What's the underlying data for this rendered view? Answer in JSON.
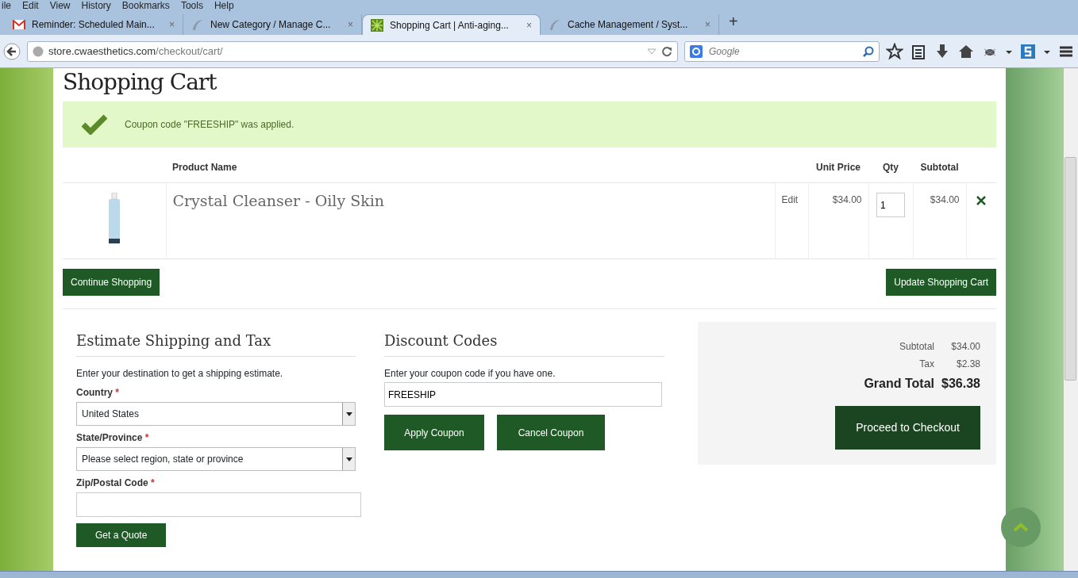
{
  "menu": [
    "ile",
    "Edit",
    "View",
    "History",
    "Bookmarks",
    "Tools",
    "Help"
  ],
  "tabs": [
    {
      "title": "Reminder: Scheduled Main...",
      "close": "×",
      "selected": false
    },
    {
      "title": "New Category / Manage C...",
      "close": "×",
      "selected": false
    },
    {
      "title": "Shopping Cart | Anti-aging...",
      "close": "×",
      "selected": true
    },
    {
      "title": "Cache Management / Syst...",
      "close": "×",
      "selected": false
    }
  ],
  "new_tab": "+",
  "address": {
    "host": "store.cwaesthetics.com",
    "path": "/checkout/cart/"
  },
  "search": {
    "placeholder": "Google"
  },
  "page": {
    "title": "Shopping Cart",
    "notice": "Coupon code \"FREESHIP\" was applied.",
    "columns": [
      "Product Name",
      "Unit Price",
      "Qty",
      "Subtotal"
    ],
    "items": [
      {
        "name": "Crystal Cleanser - Oily Skin",
        "edit": "Edit",
        "unit_price": "$34.00",
        "qty": "1",
        "subtotal": "$34.00"
      }
    ],
    "continue": "Continue Shopping",
    "update": "Update Shopping Cart",
    "shipping": {
      "title": "Estimate Shipping and Tax",
      "intro": "Enter your destination to get a shipping estimate.",
      "country_label": "Country",
      "country": "United States",
      "state_label": "State/Province",
      "state": "Please select region, state or province",
      "zip_label": "Zip/Postal Code",
      "required": "*",
      "quote": "Get a Quote"
    },
    "discount": {
      "title": "Discount Codes",
      "intro": "Enter your coupon code if you have one.",
      "code": "FREESHIP",
      "apply": "Apply Coupon",
      "cancel": "Cancel Coupon"
    },
    "totals": [
      {
        "label": "Subtotal",
        "value": "$34.00",
        "kind": "line"
      },
      {
        "label": "Tax",
        "value": "$2.38",
        "kind": "line"
      },
      {
        "label": "Grand Total",
        "value": "$36.38",
        "kind": "grand"
      }
    ],
    "checkout": "Proceed to Checkout"
  }
}
